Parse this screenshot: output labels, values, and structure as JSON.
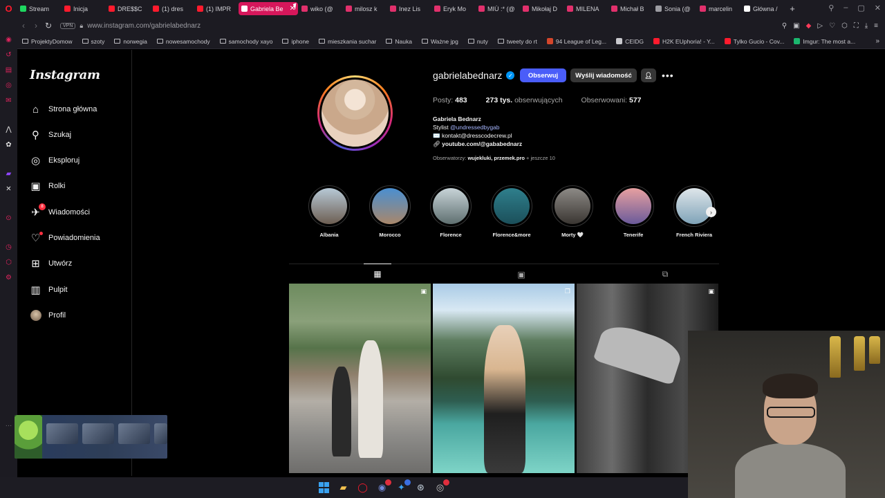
{
  "browser": {
    "tabs": [
      {
        "label": "Stream",
        "color": "#1ed760"
      },
      {
        "label": "Inicja",
        "color": "#ff1b2d"
      },
      {
        "label": "DRE$$C",
        "color": "#ff1b2d"
      },
      {
        "label": "(1) dres",
        "color": "#ff1b2d"
      },
      {
        "label": "(1) IMPR",
        "color": "#ff1b2d"
      },
      {
        "label": "Gabriela Be",
        "color": "#ffffff",
        "active": true
      },
      {
        "label": "wiko (@",
        "color": "#e1306c"
      },
      {
        "label": "milosz k",
        "color": "#e1306c"
      },
      {
        "label": "Inez Lis",
        "color": "#e1306c"
      },
      {
        "label": "Eryk Mo",
        "color": "#e1306c"
      },
      {
        "label": "MIÚ :* (@",
        "color": "#e1306c"
      },
      {
        "label": "Mikołaj D",
        "color": "#e1306c"
      },
      {
        "label": "MILENA",
        "color": "#e1306c"
      },
      {
        "label": "Michał B",
        "color": "#e1306c"
      },
      {
        "label": "Sonia (@",
        "color": "#9c9ca2"
      },
      {
        "label": "marcelin",
        "color": "#e1306c"
      },
      {
        "label": "Główna /",
        "color": "#ffffff"
      }
    ],
    "address": {
      "vpn": "VPN",
      "url": "www.instagram.com/gabrielabednarz"
    },
    "bookmarks": [
      {
        "label": "ProjektyDomow",
        "type": "folder"
      },
      {
        "label": "szoty",
        "type": "folder"
      },
      {
        "label": "norwegia",
        "type": "folder"
      },
      {
        "label": "nowesamochody",
        "type": "folder"
      },
      {
        "label": "samochody xayo",
        "type": "folder"
      },
      {
        "label": "iphone",
        "type": "folder"
      },
      {
        "label": "mieszkania suchar",
        "type": "folder"
      },
      {
        "label": "Nauka",
        "type": "folder"
      },
      {
        "label": "Ważne jpg",
        "type": "folder"
      },
      {
        "label": "nuty",
        "type": "folder"
      },
      {
        "label": "tweety do rt",
        "type": "folder"
      },
      {
        "label": "94 League of Leg...",
        "type": "site",
        "color": "#d4462b"
      },
      {
        "label": "CEIDG",
        "type": "site",
        "color": "#c9c9ce"
      },
      {
        "label": "H2K EUphoria! - Y...",
        "type": "site",
        "color": "#ff1b2d"
      },
      {
        "label": "Tylko Gucio - Cov...",
        "type": "site",
        "color": "#ff1b2d"
      },
      {
        "label": "Imgur: The most a...",
        "type": "site",
        "color": "#1bb76e"
      }
    ]
  },
  "instagram": {
    "logo": "Instagram",
    "nav": [
      {
        "label": "Strona główna",
        "icon": "home-icon",
        "glyph": "⌂"
      },
      {
        "label": "Szukaj",
        "icon": "search-icon",
        "glyph": "⚲"
      },
      {
        "label": "Eksploruj",
        "icon": "compass-icon",
        "glyph": "◎"
      },
      {
        "label": "Rolki",
        "icon": "reels-icon",
        "glyph": "▣"
      },
      {
        "label": "Wiadomości",
        "icon": "messenger-icon",
        "glyph": "✈",
        "badge": "8"
      },
      {
        "label": "Powiadomienia",
        "icon": "heart-icon",
        "glyph": "♡",
        "dot": true
      },
      {
        "label": "Utwórz",
        "icon": "create-icon",
        "glyph": "⊞"
      },
      {
        "label": "Pulpit",
        "icon": "dashboard-icon",
        "glyph": "▥"
      },
      {
        "label": "Profil",
        "icon": "avatar-icon",
        "glyph": ""
      }
    ],
    "profile": {
      "username": "gabrielabednarz",
      "follow_label": "Obserwuj",
      "message_label": "Wyślij wiadomość",
      "stats": {
        "posts_label": "Posty:",
        "posts": "483",
        "followers": "273 tys.",
        "followers_label": "obserwujących",
        "following_label": "Obserwowani:",
        "following": "577"
      },
      "bio": {
        "name": "Gabriela Bednarz",
        "line1_prefix": "Stylist ",
        "line1_tag": "@undressedbygab",
        "line2": "✉️ kontakt@dresscodecrew.pl",
        "link": "youtube.com/@gababednarz"
      },
      "followed_by": {
        "prefix": "Obserwatorzy: ",
        "users": "wujekluki, przemek.pro",
        "suffix": " + jeszcze 10"
      }
    },
    "highlights": [
      {
        "label": "Albania",
        "c1": "#b7c9d6",
        "c2": "#6d5e52"
      },
      {
        "label": "Morocco",
        "c1": "#4a8fd1",
        "c2": "#a9876a"
      },
      {
        "label": "Florence",
        "c1": "#c8d4d8",
        "c2": "#5f6f70"
      },
      {
        "label": "Florence&more",
        "c1": "#2f7f8c",
        "c2": "#1b4f5a"
      },
      {
        "label": "Morty 🤍",
        "c1": "#8d8a86",
        "c2": "#3a3632"
      },
      {
        "label": "Tenerife",
        "c1": "#e7a0a0",
        "c2": "#6a5a9a"
      },
      {
        "label": "French Riviera",
        "c1": "#dfe6ea",
        "c2": "#7fa3b8"
      }
    ]
  }
}
